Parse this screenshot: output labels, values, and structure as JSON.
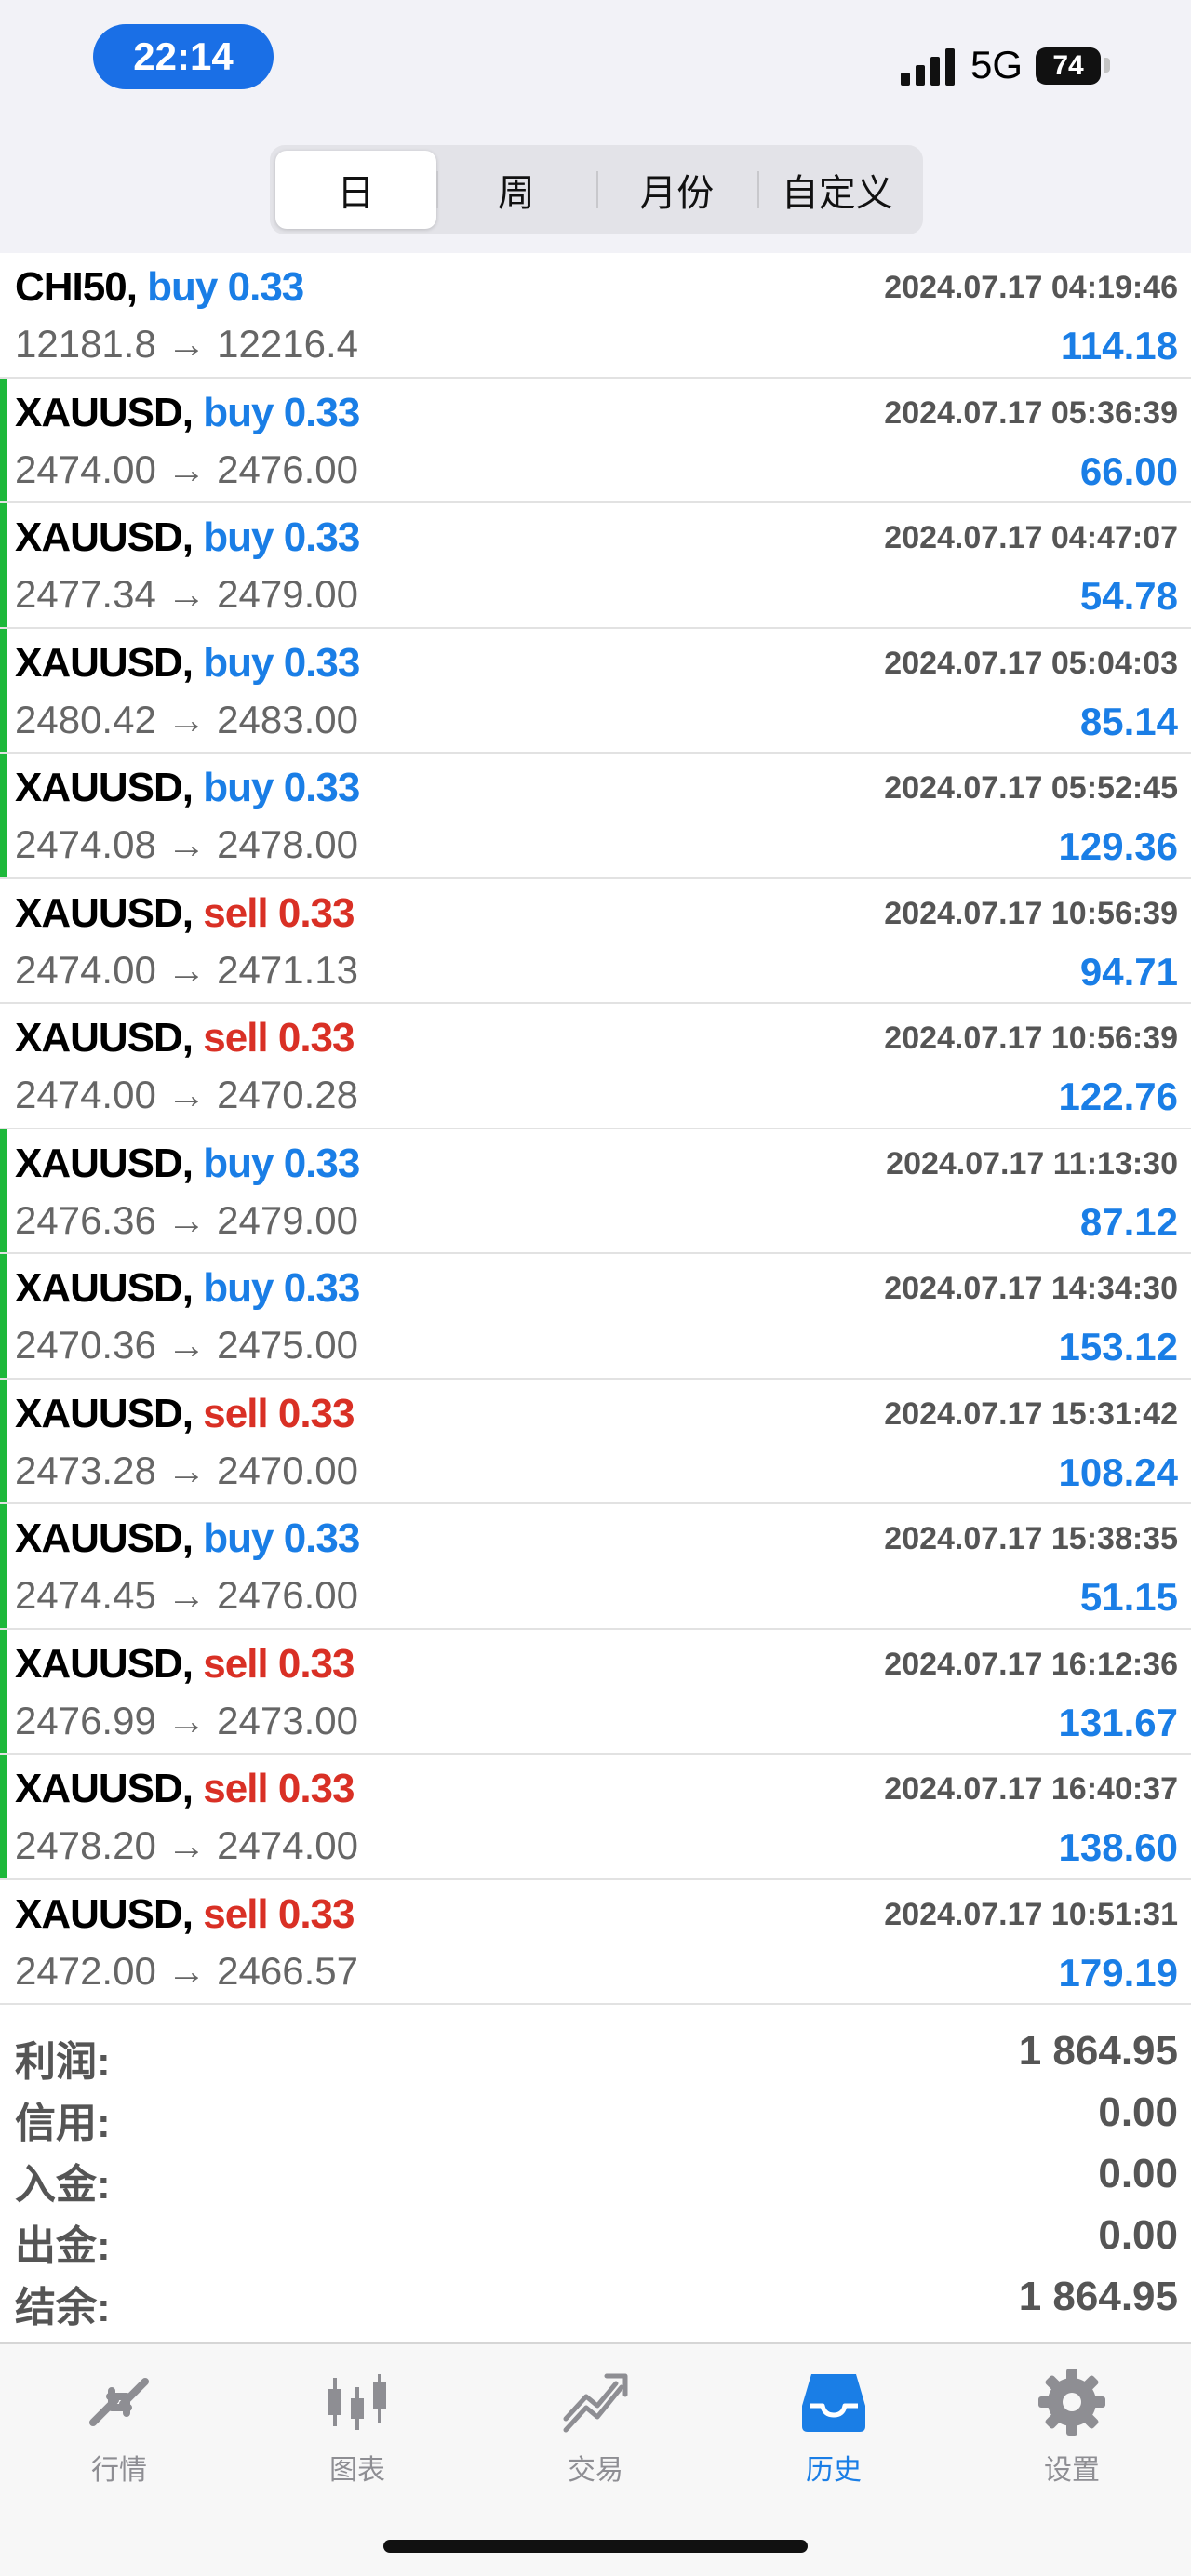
{
  "status_bar": {
    "time": "22:14",
    "network": "5G",
    "battery": "74"
  },
  "segment": {
    "items": [
      "日",
      "周",
      "月份",
      "自定义"
    ],
    "active": 0
  },
  "trades": [
    {
      "symbol": "CHI50",
      "side": "buy",
      "side_label": "buy 0.33",
      "date": "2024.07.17 04:19:46",
      "prices": "12181.8 → 12216.4",
      "profit": "114.18"
    },
    {
      "symbol": "XAUUSD",
      "side": "buy",
      "side_label": "buy 0.33",
      "date": "2024.07.17 05:36:39",
      "prices": "2474.00 → 2476.00",
      "profit": "66.00"
    },
    {
      "symbol": "XAUUSD",
      "side": "buy",
      "side_label": "buy 0.33",
      "date": "2024.07.17 04:47:07",
      "prices": "2477.34 → 2479.00",
      "profit": "54.78"
    },
    {
      "symbol": "XAUUSD",
      "side": "buy",
      "side_label": "buy 0.33",
      "date": "2024.07.17 05:04:03",
      "prices": "2480.42 → 2483.00",
      "profit": "85.14"
    },
    {
      "symbol": "XAUUSD",
      "side": "buy",
      "side_label": "buy 0.33",
      "date": "2024.07.17 05:52:45",
      "prices": "2474.08 → 2478.00",
      "profit": "129.36"
    },
    {
      "symbol": "XAUUSD",
      "side": "sell",
      "side_label": "sell 0.33",
      "date": "2024.07.17 10:56:39",
      "prices": "2474.00 → 2471.13",
      "profit": "94.71"
    },
    {
      "symbol": "XAUUSD",
      "side": "sell",
      "side_label": "sell 0.33",
      "date": "2024.07.17 10:56:39",
      "prices": "2474.00 → 2470.28",
      "profit": "122.76"
    },
    {
      "symbol": "XAUUSD",
      "side": "buy",
      "side_label": "buy 0.33",
      "date": "2024.07.17 11:13:30",
      "prices": "2476.36 → 2479.00",
      "profit": "87.12"
    },
    {
      "symbol": "XAUUSD",
      "side": "buy",
      "side_label": "buy 0.33",
      "date": "2024.07.17 14:34:30",
      "prices": "2470.36 → 2475.00",
      "profit": "153.12"
    },
    {
      "symbol": "XAUUSD",
      "side": "sell",
      "side_label": "sell 0.33",
      "date": "2024.07.17 15:31:42",
      "prices": "2473.28 → 2470.00",
      "profit": "108.24"
    },
    {
      "symbol": "XAUUSD",
      "side": "buy",
      "side_label": "buy 0.33",
      "date": "2024.07.17 15:38:35",
      "prices": "2474.45 → 2476.00",
      "profit": "51.15"
    },
    {
      "symbol": "XAUUSD",
      "side": "sell",
      "side_label": "sell 0.33",
      "date": "2024.07.17 16:12:36",
      "prices": "2476.99 → 2473.00",
      "profit": "131.67"
    },
    {
      "symbol": "XAUUSD",
      "side": "sell",
      "side_label": "sell 0.33",
      "date": "2024.07.17 16:40:37",
      "prices": "2478.20 → 2474.00",
      "profit": "138.60"
    },
    {
      "symbol": "XAUUSD",
      "side": "sell",
      "side_label": "sell 0.33",
      "date": "2024.07.17 10:51:31",
      "prices": "2472.00 → 2466.57",
      "profit": "179.19"
    }
  ],
  "green_marked_rows": [
    1,
    2,
    3,
    4,
    7,
    8,
    9,
    10,
    11,
    12
  ],
  "summary": [
    {
      "label": "利润:",
      "value": "1 864.95"
    },
    {
      "label": "信用:",
      "value": "0.00"
    },
    {
      "label": "入金:",
      "value": "0.00"
    },
    {
      "label": "出金:",
      "value": "0.00"
    },
    {
      "label": "结余:",
      "value": "1 864.95"
    }
  ],
  "tabbar": {
    "items": [
      {
        "label": "行情",
        "icon": "quotes-icon"
      },
      {
        "label": "图表",
        "icon": "chart-icon"
      },
      {
        "label": "交易",
        "icon": "trade-icon"
      },
      {
        "label": "历史",
        "icon": "history-icon"
      },
      {
        "label": "设置",
        "icon": "settings-icon"
      }
    ],
    "active": 3
  },
  "colors": {
    "buy": "#1a7ee6",
    "sell": "#d93025",
    "profit": "#1a7ee6",
    "mark": "#1db83a",
    "accent": "#1a6fe6"
  }
}
